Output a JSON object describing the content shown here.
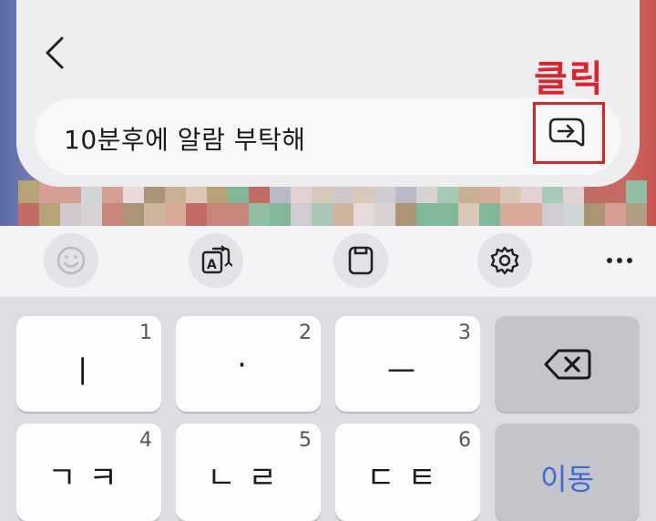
{
  "input": {
    "text": "10분후에 알람 부탁해"
  },
  "annotation": {
    "label": "클릭"
  },
  "toolbar": {
    "items": [
      {
        "name": "emoji-icon"
      },
      {
        "name": "translate-icon"
      },
      {
        "name": "clipboard-icon"
      },
      {
        "name": "gear-icon"
      },
      {
        "name": "more-icon"
      }
    ]
  },
  "keyboard": {
    "row1": [
      {
        "num": "1",
        "label": "ㅣ"
      },
      {
        "num": "2",
        "label": "·"
      },
      {
        "num": "3",
        "label": "ㅡ"
      }
    ],
    "row2": [
      {
        "num": "4",
        "label": "ㄱㅋ"
      },
      {
        "num": "5",
        "label": "ㄴㄹ"
      },
      {
        "num": "6",
        "label": "ㄷㅌ"
      }
    ],
    "move_label": "이동"
  },
  "colors": {
    "annotation": "#e2222b",
    "accent": "#3b6bd6"
  }
}
